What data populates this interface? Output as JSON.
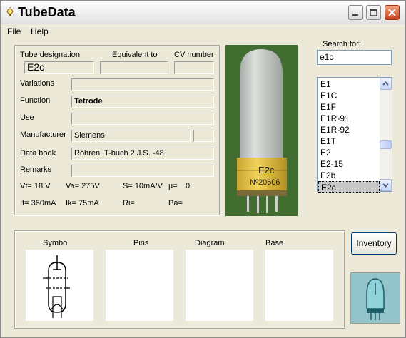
{
  "window": {
    "title": "TubeData"
  },
  "menu": {
    "file": "File",
    "help": "Help"
  },
  "header": {
    "designation_label": "Tube designation",
    "equivalent_label": "Equivalent to",
    "cv_label": "CV number"
  },
  "tube": {
    "designation": "E2c",
    "equivalent": "",
    "cv_number": "",
    "variations": "",
    "function": "Tetrode",
    "use": "",
    "manufacturer": "Siemens",
    "manufacturer_extra": "",
    "data_book": "Röhren. T-buch 2 J.S. -48",
    "remarks": ""
  },
  "labels": {
    "variations": "Variations",
    "function": "Function",
    "use": "Use",
    "manufacturer": "Manufacturer",
    "data_book": "Data book",
    "remarks": "Remarks"
  },
  "params": {
    "vf": "Vf= 18 V",
    "va": "Va= 275V",
    "s": "S= 10mA/V",
    "mu": "µ=",
    "mu_value": "0",
    "if": "If= 360mA",
    "ik": "Ik= 75mA",
    "ri": "Ri=",
    "pa": "Pa="
  },
  "photo": {
    "label": "E2c",
    "number": "Nº20606"
  },
  "search": {
    "label": "Search for:",
    "value": "e1c"
  },
  "list": {
    "items": [
      "E1",
      "E1C",
      "E1F",
      "E1R-91",
      "E1R-92",
      "E1T",
      "E2",
      "E2-15",
      "E2b",
      "E2c"
    ],
    "selected": "E2c"
  },
  "bottom": {
    "symbol": "Symbol",
    "pins": "Pins",
    "diagram": "Diagram",
    "base": "Base"
  },
  "buttons": {
    "inventory": "Inventory"
  }
}
